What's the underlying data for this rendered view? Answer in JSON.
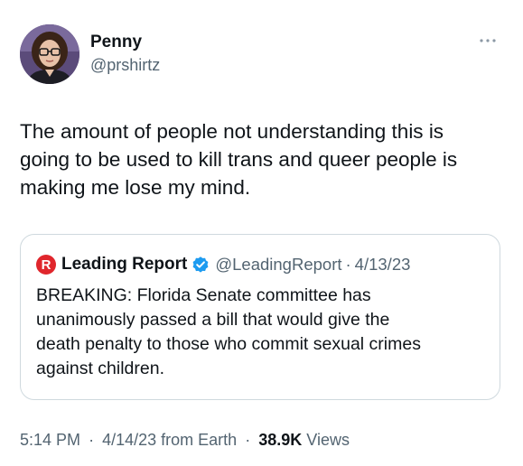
{
  "author": {
    "display_name": "Penny",
    "handle": "@prshirtz",
    "avatar_icon": "user-avatar"
  },
  "more_icon": "more-horizontal-icon",
  "tweet": {
    "text": "The amount of people not understanding this is\ngoing to be used to kill trans and queer people is\nmaking me lose my mind."
  },
  "quote": {
    "logo_letter": "R",
    "logo_color": "#e0262c",
    "display_name": "Leading Report",
    "verified_icon": "verified-badge-icon",
    "verified_color": "#1d9bf0",
    "handle": "@LeadingReport",
    "separator": "·",
    "date": "4/13/23",
    "text": "BREAKING: Florida Senate committee has\nunanimously passed a bill that would give the\ndeath penalty to those who commit sexual crimes\nagainst children."
  },
  "meta": {
    "time": "5:14 PM",
    "separator": "·",
    "date": "4/14/23",
    "source": "from Earth",
    "views_count": "38.9K",
    "views_label": "Views"
  }
}
